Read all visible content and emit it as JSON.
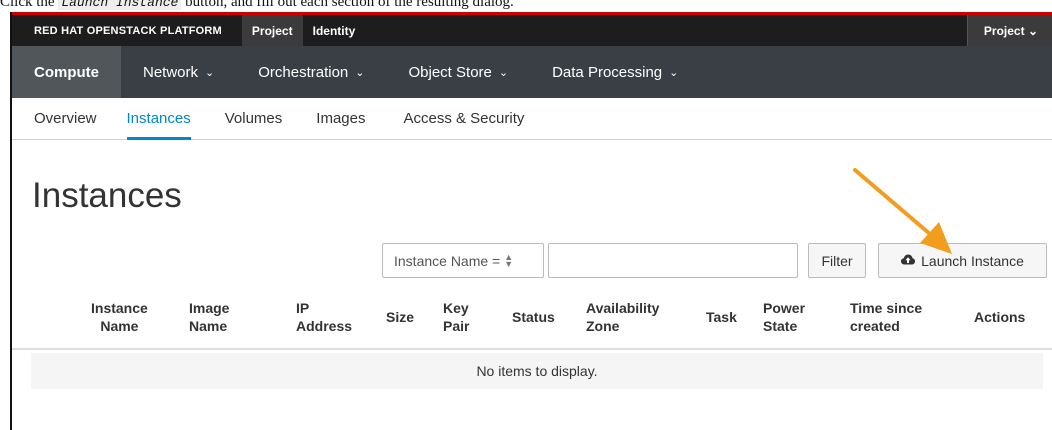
{
  "caption": {
    "before": "Click the",
    "code": "Launch Instance",
    "after": "button, and fill out each section of the resulting dialog."
  },
  "topbar": {
    "brand": "RED HAT OPENSTACK PLATFORM",
    "tabs": [
      {
        "label": "Project",
        "active": true
      },
      {
        "label": "Identity",
        "active": false
      }
    ],
    "project_menu": "Project ⌄"
  },
  "compute_nav": {
    "items": [
      {
        "label": "Compute"
      },
      {
        "label": "Network"
      },
      {
        "label": "Orchestration"
      },
      {
        "label": "Object Store"
      },
      {
        "label": "Data Processing"
      }
    ]
  },
  "sub_nav": {
    "items": [
      {
        "label": "Overview"
      },
      {
        "label": "Instances"
      },
      {
        "label": "Volumes"
      },
      {
        "label": "Images"
      },
      {
        "label": "Access & Security"
      }
    ]
  },
  "page_title": "Instances",
  "filter": {
    "select_value": "Instance Name =",
    "input_value": "",
    "filter_button": "Filter",
    "launch_button": "Launch Instance"
  },
  "table": {
    "columns": [
      {
        "l1": "Instance",
        "l2": "Name"
      },
      {
        "l1": "Image",
        "l2": "Name"
      },
      {
        "l1": "IP",
        "l2": "Address"
      },
      {
        "l1": "Size",
        "l2": ""
      },
      {
        "l1": "Key",
        "l2": "Pair"
      },
      {
        "l1": "Status",
        "l2": ""
      },
      {
        "l1": "Availability",
        "l2": "Zone"
      },
      {
        "l1": "Task",
        "l2": ""
      },
      {
        "l1": "Power",
        "l2": "State"
      },
      {
        "l1": "Time since",
        "l2": "created"
      },
      {
        "l1": "Actions",
        "l2": ""
      }
    ],
    "empty_message": "No items to display."
  },
  "colors": {
    "accent": "#0088ce",
    "brand_red": "#cc0000",
    "arrow": "#f39d1e"
  }
}
